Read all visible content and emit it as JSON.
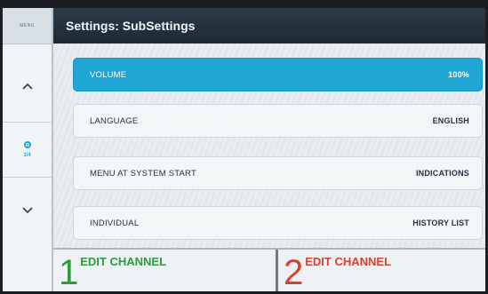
{
  "sidebar": {
    "menu_label": "MENU",
    "page_indicator": "1/4"
  },
  "header": {
    "title": "Settings:  SubSettings"
  },
  "settings": [
    {
      "label": "VOLUME",
      "value": "100%",
      "active": true
    },
    {
      "label": "LANGUAGE",
      "value": "ENGLISH",
      "active": false
    },
    {
      "label": "MENU AT SYSTEM START",
      "value": "INDICATIONS",
      "active": false
    },
    {
      "label": "INDIVIDUAL",
      "value": "HISTORY LIST",
      "active": false
    }
  ],
  "footer": {
    "btn1": {
      "number": "1",
      "label": "EDIT CHANNEL"
    },
    "btn2": {
      "number": "2",
      "label": "EDIT CHANNEL"
    }
  },
  "colors": {
    "accent": "#1fa6d5",
    "channel1": "#2e9a3e",
    "channel2": "#d8412f"
  }
}
